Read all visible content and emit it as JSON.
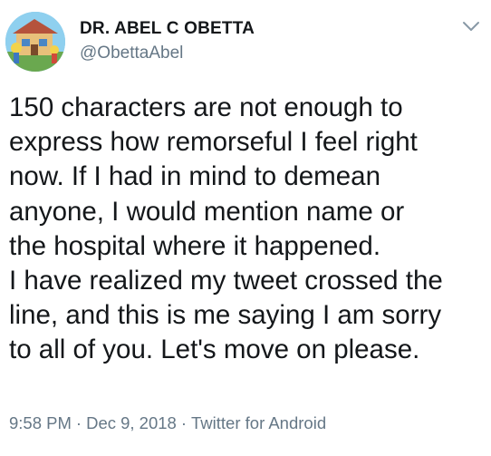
{
  "author": {
    "display_name": "DR. ABEL C OBETTA",
    "handle": "@ObettaAbel"
  },
  "tweet": {
    "lines": [
      "150 characters are not enough to",
      "express how remorseful I feel right",
      "now. If I had in mind to demean",
      "anyone, I would mention name or",
      "the hospital where it happened.",
      "I have realized my tweet crossed the",
      "line, and this is me saying I am sorry",
      "to all of you. Let's move on please."
    ]
  },
  "meta": {
    "time": "9:58 PM",
    "separator": "·",
    "date": "Dec 9, 2018",
    "source": "Twitter for Android"
  },
  "icons": {
    "menu": "chevron-down-icon",
    "avatar": "cartoon-profile-picture"
  },
  "colors": {
    "text": "#14171a",
    "secondary": "#657786"
  }
}
